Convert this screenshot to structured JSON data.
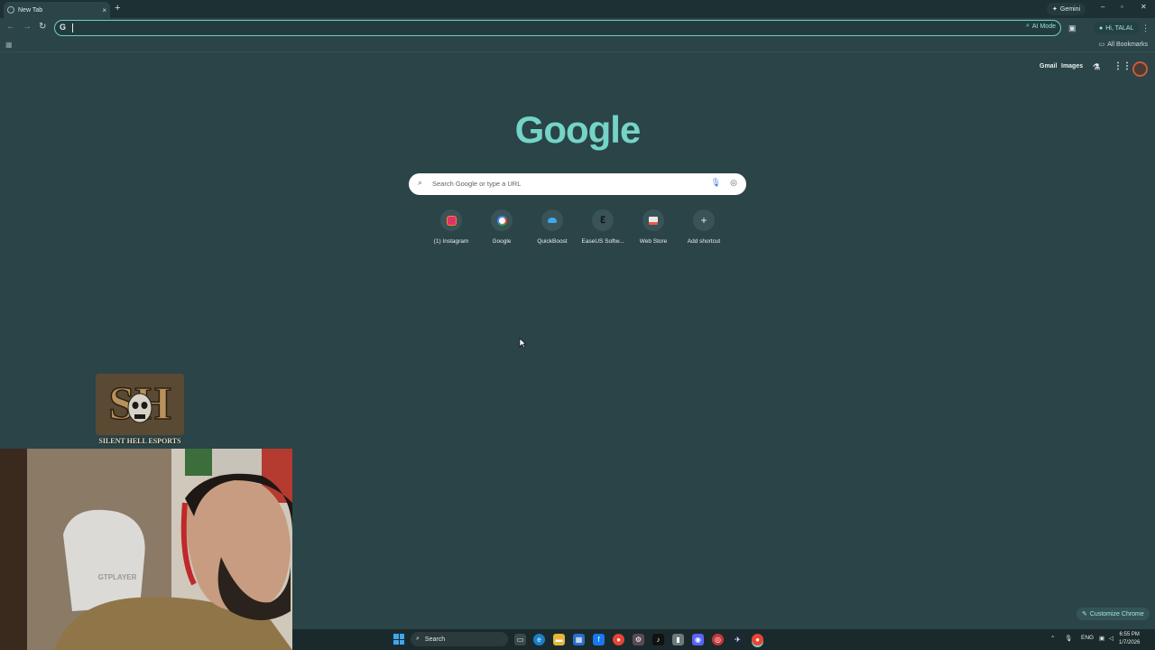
{
  "browser": {
    "tab_title": "New Tab",
    "tab_close": "×",
    "new_tab": "+",
    "gemini_label": "Gemini",
    "window_controls": [
      "–",
      "▫",
      "✕"
    ],
    "omnibox_value": "",
    "ai_mode_label": "AI Mode",
    "profile_label": "Hi, TALAL",
    "all_bookmarks": "All Bookmarks"
  },
  "ntp": {
    "links": [
      "Gmail",
      "Images"
    ],
    "logo_text": "Google",
    "search_placeholder": "Search Google or type a URL",
    "shortcuts": [
      {
        "label": "(1) Instagram",
        "icon": "instagram-icon",
        "color": "#e1306c"
      },
      {
        "label": "Google",
        "icon": "google-icon",
        "color": "#4285f4"
      },
      {
        "label": "QuickBoost",
        "icon": "quickboost-icon",
        "color": "#3fa7f0"
      },
      {
        "label": "EaseUS Softw...",
        "icon": "easeus-icon",
        "color": "#222222"
      },
      {
        "label": "Web Store",
        "icon": "web-store-icon",
        "color": "#e75a4b"
      },
      {
        "label": "Add shortcut",
        "icon": "plus-icon",
        "color": "#e8f0f0"
      }
    ],
    "customize_label": "Customize Chrome"
  },
  "overlay": {
    "logo_text": "SILENT HELL ESPORTS",
    "logo_monogram": "SH",
    "chair_text": "GTPLAYER"
  },
  "taskbar": {
    "search_label": "Search",
    "language": "ENG",
    "time": "6:55 PM",
    "date": "1/7/2026"
  },
  "colors": {
    "background": "#2b4447",
    "accent": "#74d4c8"
  }
}
